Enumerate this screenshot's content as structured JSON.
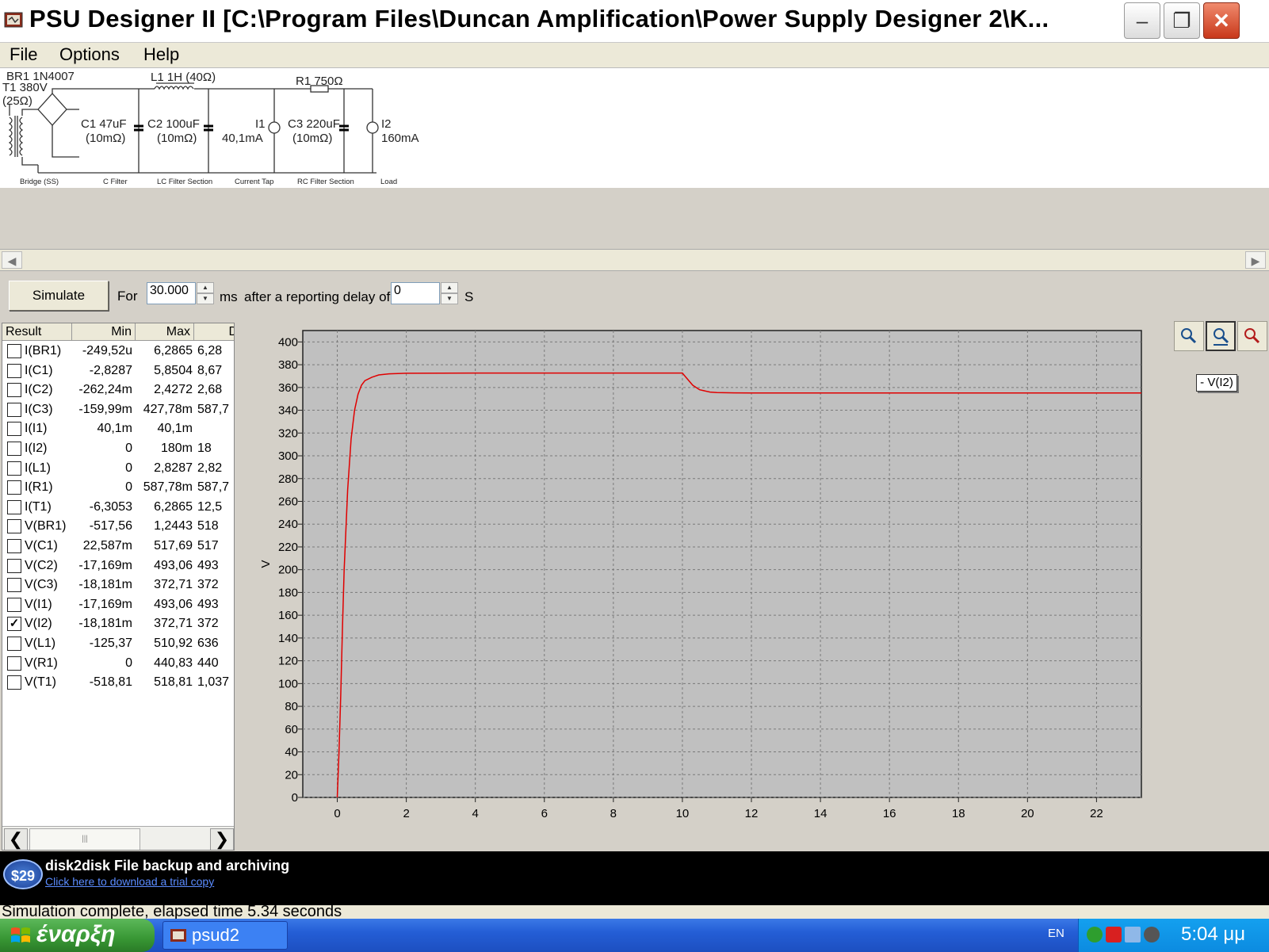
{
  "window": {
    "title": "PSU Designer II  [C:\\Program Files\\Duncan Amplification\\Power Supply Designer 2\\K...",
    "minimize": "–",
    "maximize": "❐",
    "close": "✕"
  },
  "menu": [
    {
      "label": "File"
    },
    {
      "label": "Options"
    },
    {
      "label": "Help"
    }
  ],
  "schematic": {
    "labels": {
      "br1": "BR1 1N4007",
      "t1": "T1 380V",
      "t1_r": "(25Ω)",
      "l1": "L1 1H (40Ω)",
      "r1": "R1 750Ω",
      "c1": "C1 47uF",
      "c1_r": "(10mΩ)",
      "c2": "C2 100uF",
      "c2_r": "(10mΩ)",
      "i1": "I1",
      "i1_v": "40,1mA",
      "c3": "C3 220uF",
      "c3_r": "(10mΩ)",
      "i2": "I2",
      "i2_v": "160mA"
    },
    "sections": [
      "Bridge (SS)",
      "C Filter",
      "LC Filter Section",
      "Current Tap",
      "RC Filter Section",
      "Load"
    ]
  },
  "simulate": {
    "button": "Simulate",
    "for_label": "For",
    "duration": "30.000",
    "ms_label": "ms",
    "delay_label": "after a reporting delay of",
    "delay": "0",
    "s_label": "S"
  },
  "results": {
    "headers": [
      "Result",
      "Min",
      "Max",
      "D"
    ],
    "rows": [
      {
        "name": "I(BR1)",
        "min": "-249,52u",
        "max": "6,2865",
        "d": "6,28",
        "checked": false
      },
      {
        "name": "I(C1)",
        "min": "-2,8287",
        "max": "5,8504",
        "d": "8,67",
        "checked": false
      },
      {
        "name": "I(C2)",
        "min": "-262,24m",
        "max": "2,4272",
        "d": "2,68",
        "checked": false
      },
      {
        "name": "I(C3)",
        "min": "-159,99m",
        "max": "427,78m",
        "d": "587,7",
        "checked": false
      },
      {
        "name": "I(I1)",
        "min": "40,1m",
        "max": "40,1m",
        "d": "",
        "checked": false
      },
      {
        "name": "I(I2)",
        "min": "0",
        "max": "180m",
        "d": "18",
        "checked": false
      },
      {
        "name": "I(L1)",
        "min": "0",
        "max": "2,8287",
        "d": "2,82",
        "checked": false
      },
      {
        "name": "I(R1)",
        "min": "0",
        "max": "587,78m",
        "d": "587,7",
        "checked": false
      },
      {
        "name": "I(T1)",
        "min": "-6,3053",
        "max": "6,2865",
        "d": "12,5",
        "checked": false
      },
      {
        "name": "V(BR1)",
        "min": "-517,56",
        "max": "1,2443",
        "d": "518",
        "checked": false
      },
      {
        "name": "V(C1)",
        "min": "22,587m",
        "max": "517,69",
        "d": "517",
        "checked": false
      },
      {
        "name": "V(C2)",
        "min": "-17,169m",
        "max": "493,06",
        "d": "493",
        "checked": false
      },
      {
        "name": "V(C3)",
        "min": "-18,181m",
        "max": "372,71",
        "d": "372",
        "checked": false
      },
      {
        "name": "V(I1)",
        "min": "-17,169m",
        "max": "493,06",
        "d": "493",
        "checked": false
      },
      {
        "name": "V(I2)",
        "min": "-18,181m",
        "max": "372,71",
        "d": "372",
        "checked": true
      },
      {
        "name": "V(L1)",
        "min": "-125,37",
        "max": "510,92",
        "d": "636",
        "checked": false
      },
      {
        "name": "V(R1)",
        "min": "0",
        "max": "440,83",
        "d": "440",
        "checked": false
      },
      {
        "name": "V(T1)",
        "min": "-518,81",
        "max": "518,81",
        "d": "1,037",
        "checked": false
      }
    ]
  },
  "plot": {
    "legend": "- V(I2)",
    "ylabel": "V",
    "trace_color": "#e00000"
  },
  "chart_data": {
    "type": "line",
    "title": "",
    "xlabel": "",
    "ylabel": "V",
    "xlim": [
      -1,
      23.3
    ],
    "ylim": [
      0,
      410
    ],
    "xticks": [
      0,
      2,
      4,
      6,
      8,
      10,
      12,
      14,
      16,
      18,
      20,
      22
    ],
    "yticks": [
      0,
      20,
      40,
      60,
      80,
      100,
      120,
      140,
      160,
      180,
      200,
      220,
      240,
      260,
      280,
      300,
      320,
      340,
      360,
      380,
      400
    ],
    "grid": true,
    "legend_position": "top-right",
    "series": [
      {
        "name": "V(I2)",
        "x": [
          0,
          0.05,
          0.1,
          0.15,
          0.2,
          0.3,
          0.4,
          0.5,
          0.6,
          0.7,
          0.8,
          1.0,
          1.2,
          1.5,
          2.0,
          4.0,
          6.0,
          8.0,
          10.0,
          10.1,
          10.3,
          10.5,
          10.8,
          11.0,
          11.5,
          12.0,
          16.0,
          20.0,
          23.3
        ],
        "y": [
          0,
          40,
          90,
          150,
          200,
          270,
          315,
          340,
          354,
          362,
          366,
          369,
          371,
          372,
          372.5,
          372.7,
          372.7,
          372.7,
          372.7,
          369,
          362,
          358,
          356,
          355.6,
          355.3,
          355.2,
          355.2,
          355.2,
          355.2
        ]
      }
    ]
  },
  "zoom": [
    "zoom-in-icon",
    "zoom-fit-icon",
    "zoom-out-icon"
  ],
  "banner": {
    "price": "$29",
    "title": "disk2disk File backup and archiving",
    "link": "Click here to download a trial copy"
  },
  "status": "Simulation complete, elapsed time 5.34 seconds",
  "taskbar": {
    "start": "έναρξη",
    "task": "psud2",
    "lang": "EN",
    "clock": "5:04 μμ"
  }
}
